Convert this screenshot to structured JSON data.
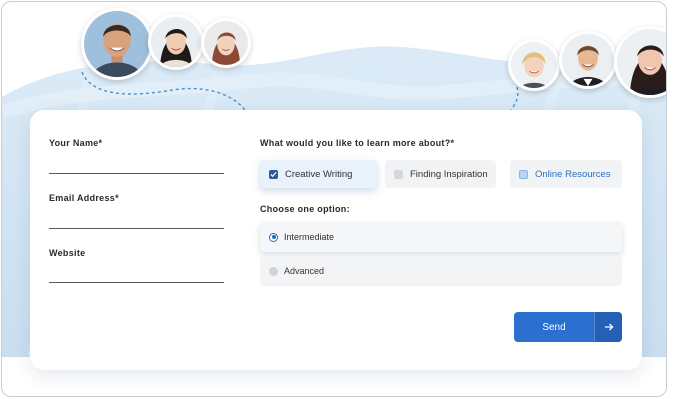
{
  "form": {
    "name_label": "Your Name*",
    "email_label": "Email Address*",
    "website_label": "Website",
    "name_value": "",
    "email_value": "",
    "website_value": ""
  },
  "interests": {
    "question": "What would you like to learn more about?*",
    "options": [
      {
        "label": "Creative Writing",
        "checked": true
      },
      {
        "label": "Finding Inspiration",
        "checked": false
      },
      {
        "label": "Online Resources",
        "checked": false
      }
    ]
  },
  "level": {
    "question": "Choose one option:",
    "options": [
      {
        "label": "Intermediate",
        "selected": true
      },
      {
        "label": "Advanced",
        "selected": false
      }
    ]
  },
  "submit": {
    "label": "Send",
    "icon": "arrow-right-icon"
  },
  "avatars": {
    "left": [
      "smiling-man-avatar",
      "asian-woman-avatar",
      "redhead-woman-avatar"
    ],
    "right": [
      "blonde-woman-avatar",
      "man-in-jacket-avatar",
      "dark-haired-woman-avatar"
    ]
  },
  "colors": {
    "accent": "#2b6fd0",
    "checked_box": "#2a5a9a",
    "link_text": "#2c6fc4",
    "backdrop": "#d7e8f6",
    "dotted_path": "#4a90c8"
  }
}
